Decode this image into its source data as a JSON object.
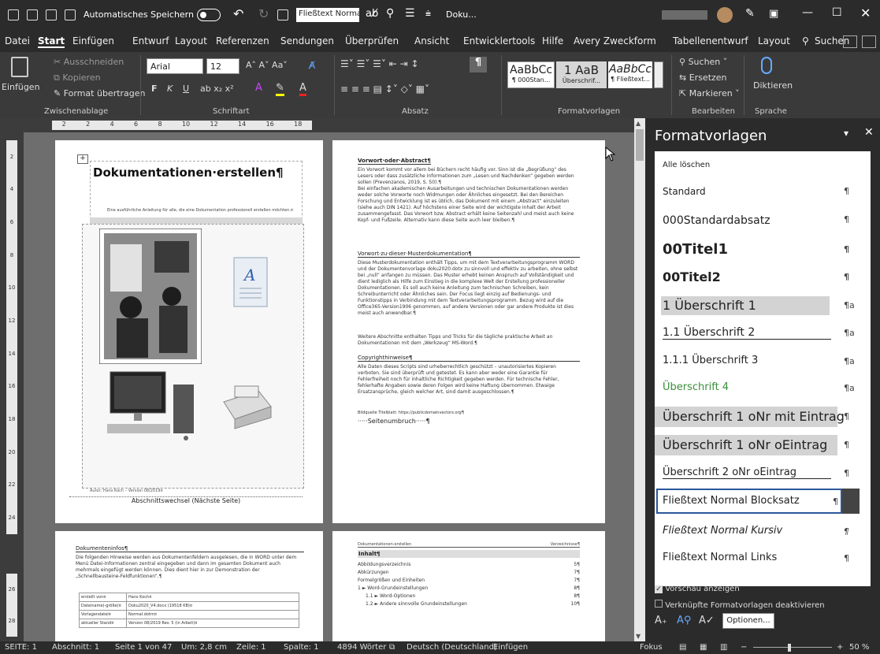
{
  "titlebar": {
    "autosave": "Automatisches Speichern",
    "style_box": "Fließtext Normal Bl",
    "doc_name": "Doku..."
  },
  "menu": {
    "items": [
      "Datei",
      "Start",
      "Einfügen",
      "Entwurf",
      "Layout",
      "Referenzen",
      "Sendungen",
      "Überprüfen",
      "Ansicht",
      "Entwicklertools",
      "Hilfe",
      "Avery Zweckform",
      "Tabellenentwurf",
      "Layout"
    ],
    "search": "Suchen"
  },
  "ribbon": {
    "clipboard": {
      "paste": "Einfügen",
      "cut": "Ausschneiden",
      "copy": "Kopieren",
      "format_painter": "Format übertragen",
      "label": "Zwischenablage"
    },
    "font": {
      "name": "Arial",
      "size": "12",
      "label": "Schriftart",
      "bold": "F",
      "italic": "K",
      "underline": "U"
    },
    "paragraph": {
      "label": "Absatz"
    },
    "styles": {
      "label": "Formatvorlagen",
      "items": [
        {
          "preview": "AaBbCc",
          "name": "¶ 000Stan..."
        },
        {
          "preview": "1 AaB",
          "name": "Überschrif..."
        },
        {
          "preview": "AaBbCc",
          "name": "¶ Fließtext..."
        }
      ]
    },
    "edit": {
      "find": "Suchen",
      "replace": "Ersetzen",
      "select": "Markieren",
      "label": "Bearbeiten"
    },
    "voice": {
      "dictate": "Diktieren",
      "label": "Sprache"
    }
  },
  "ruler": {
    "marks": [
      "2",
      "2",
      "4",
      "6",
      "8",
      "10",
      "12",
      "14",
      "16",
      "18"
    ]
  },
  "vruler": {
    "marks": [
      "2",
      "4",
      "6",
      "8",
      "10",
      "12",
      "14",
      "16",
      "18",
      "20",
      "22",
      "24",
      "26",
      "28"
    ]
  },
  "page1": {
    "title": "Dokumentationen·erstellen¶",
    "subtitle": "Eine ausführliche Anleitung für alle, die eine Dokumentation professionell erstellen möchten.¤",
    "footer": "Autor: Hans Koch – Version 08/2019¤",
    "section_break": "Abschnittswechsel (Nächste Seite)"
  },
  "page2": {
    "h1": "Vorwort·oder·Abstract¶",
    "p1": "Ein Vorwort kommt vor allem bei Büchern recht häufig vor. Sinn ist die „Begrüßung“ des Lesers oder dass zusätzliche Informationen zum „Lesen und Nachdenken“ gegeben werden sollen (Prevenzanos, 2019, S. 50).¶",
    "p2": "Bei einfachen akademischen Ausarbeitungen und technischen Dokumentationen werden weder solche Vorworte noch Widmungen oder Ähnliches eingesetzt. Bei den Bereichen Forschung und Entwicklung ist es üblich, das Dokument mit einem „Abstract“ einzuleiten (siehe auch DIN 1421). Auf höchstens einer Seite wird der wichtigste Inhalt der Arbeit zusammengefasst. Das Vorwort bzw. Abstract erhält keine Seitenzahl und meist auch keine Kopf- und Fußzeile. Alternativ kann diese Seite auch leer bleiben.¶",
    "h2": "Vorwort·zu·dieser·Musterdokumentation¶",
    "p3": "Diese Musterdokumentation enthält Tipps, um mit dem Textverarbeitungsprogramm WORD und der Dokumentenvorlage doku2020.dotx zu sinnvoll und effektiv zu arbeiten, ohne selbst bei „null“ anfangen zu müssen. Das Muster erhebt keinen Anspruch auf Vollständigkeit und dient lediglich als Hilfe zum Einstieg in die komplexe Welt der Erstellung professioneller Dokumentationen. Es soll auch keine Anleitung zum technischen Schreiben, kein Schreibunterricht oder Ähnliches sein. Der Focus liegt einzig auf Bedienungs- und Funktionstipps in Verbindung mit dem Textverarbeitungsprogramm. Bezug wird auf die Office365-Version1906 genommen, auf andere Versionen oder gar andere Produkte ist dies meist auch anwendbar.¶",
    "p4": "Weitere Abschnitte enthalten Tipps und Tricks für die tägliche praktische Arbeit an Dokumentationen mit dem „Werkzeug“ MS-Word.¶",
    "h3": "Copyrighthinweise¶",
    "p5": "Alle Daten dieses Scripts sind urheberrechtlich geschützt – unautorisiertes Kopieren verboten. Sie sind überprüft und getestet. Es kann aber weder eine Garantie für Fehlerfreiheit noch für inhaltliche Richtigkeit gegeben werden. Für technische Fehler, fehlerhafte Angaben sowie deren Folgen wird keine Haftung übernommen. Etwaige Ersatzansprüche, gleich welcher Art, sind damit ausgeschlossen.¶",
    "p6": "Bildquelle Titelblatt: https://publicdomainvectors.org¶",
    "pagebreak": "·····Seitenumbruch·····¶"
  },
  "page3": {
    "h": "Dokumenteninfos¶",
    "p": "Die folgenden Hinweise werden aus Dokumentenfeldern ausgelesen, die in WORD unter dem Menü Datei-Informationen zentral eingegeben und dann im gesamten Dokument auch mehrmals eingefügt werden können. Dies dient hier in zur Demonstration der „Schnellbausteine-Feldfunktionen“.¶",
    "rows": [
      [
        "erstellt von¤",
        "Hans Koch¤"
      ],
      [
        "Dateiname(-größe)¤",
        "Doku2020_V4.docx (19518 KB)¤"
      ],
      [
        "Vorlagendatei¤",
        "Normal.dotm¤"
      ],
      [
        "aktueller Stand¤",
        "Version 08/2019 Rev. 5 (in Arbeit)¤"
      ]
    ]
  },
  "page4": {
    "header_left": "Dokumentationen·erstellen",
    "header_right": "Verzeichnisse¶",
    "title": "Inhalt¶",
    "toc": [
      {
        "t": "Abbildungsverzeichnis",
        "p": "5¶"
      },
      {
        "t": "Abkürzungen",
        "p": "7¶"
      },
      {
        "t": "Formelgrößen und Einheiten",
        "p": "7¶"
      },
      {
        "t": "1 ► Word-Grundeinstellungen",
        "p": "8¶"
      },
      {
        "t": "1.1 ► Word-Optionen",
        "p": "8¶"
      },
      {
        "t": "1.2 ► Andere sinnvolle Grundeinstellungen",
        "p": "10¶"
      }
    ]
  },
  "pane": {
    "title": "Formatvorlagen",
    "clear_all": "Alle löschen",
    "styles": [
      {
        "name": "Standard",
        "mark": "¶"
      },
      {
        "name": "000Standardabsatz",
        "mark": "¶"
      },
      {
        "name": "00Titel1",
        "mark": "¶"
      },
      {
        "name": "00Titel2",
        "mark": "¶"
      },
      {
        "name": "1  Überschrift 1",
        "mark": "¶a"
      },
      {
        "name": "1.1  Überschrift 2",
        "mark": "¶a"
      },
      {
        "name": "1.1.1  Überschrift 3",
        "mark": "¶a"
      },
      {
        "name": "Überschrift 4",
        "mark": "¶a"
      },
      {
        "name": "Überschrift 1 oNr mit Eintrag",
        "mark": "¶"
      },
      {
        "name": "Überschrift 1 oNr oEintrag",
        "mark": "¶"
      },
      {
        "name": "Überschrift 2 oNr oEintrag",
        "mark": "¶"
      },
      {
        "name": "Fließtext Normal Blocksatz",
        "mark": "¶"
      },
      {
        "name": "Fließtext Normal Kursiv",
        "mark": "¶"
      },
      {
        "name": "Fließtext Normal Links",
        "mark": "¶"
      }
    ],
    "preview": "Vorschau anzeigen",
    "linked": "Verknüpfte Formatvorlagen deaktivieren",
    "options": "Optionen..."
  },
  "status": {
    "page": "SEITE: 1",
    "section": "Abschnitt: 1",
    "pages": "Seite 1 von 47",
    "at": "Um: 2,8 cm",
    "line": "Zeile: 1",
    "col": "Spalte: 1",
    "words": "4894 Wörter",
    "lang": "Deutsch (Deutschland)",
    "mode": "Einfügen",
    "focus": "Fokus",
    "zoom": "50 %"
  }
}
